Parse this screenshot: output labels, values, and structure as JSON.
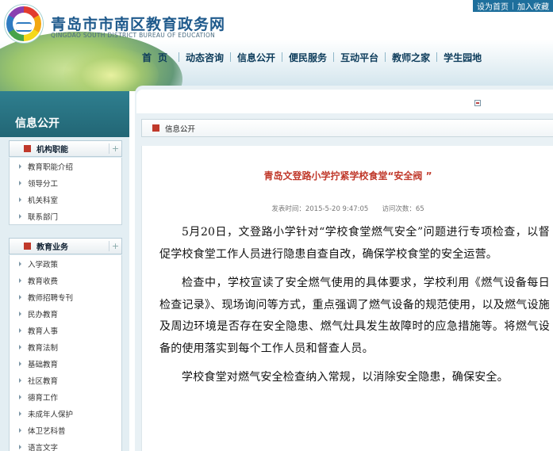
{
  "site": {
    "title": "青岛市市南区教育政务网",
    "subtitle": "QINGDAO SOUTH DISTRICT BUREAU OF EDUCATION",
    "top_links": [
      "设为首页",
      "加入收藏"
    ]
  },
  "nav": [
    "首页",
    "动态咨询",
    "信息公开",
    "便民服务",
    "互动平台",
    "教师之家",
    "学生园地"
  ],
  "sidebar": {
    "title": "信息公开",
    "sections": [
      {
        "label": "机构职能",
        "items": [
          "教育职能介绍",
          "领导分工",
          "机关科室",
          "联系部门"
        ]
      },
      {
        "label": "教育业务",
        "items": [
          "入学政策",
          "教育收费",
          "教师招聘专刊",
          "民办教育",
          "教育人事",
          "教育法制",
          "基础教育",
          "社区教育",
          "德育工作",
          "未成年人保护",
          "体卫艺科普",
          "语言文字"
        ]
      }
    ]
  },
  "breadcrumb": "信息公开",
  "article": {
    "title": "青岛文登路小学拧紧学校食堂“安全阀 ”",
    "meta": "发表时间：2015-5-20 9:47:05　　访问次数：65",
    "paragraphs": [
      "5月20日，文登路小学针对“学校食堂燃气安全”问题进行专项检查，以督促学校食堂工作人员进行隐患自查自改，确保学校食堂的安全运营。",
      "检查中，学校宣读了安全燃气使用的具体要求，学校利用《燃气设备每日检查记录》、现场询问等方式，重点强调了燃气设备的规范使用，以及燃气设施及周边环境是否存在安全隐患、燃气灶具发生故障时的应急措施等。将燃气设备的使用落实到每个工作人员和督查人员。",
      "学校食堂对燃气安全检查纳入常规，以消除安全隐患，确保安全。"
    ]
  },
  "colors": {
    "accent": "#c0392b",
    "nav_text": "#0d3c5b",
    "sidebar_title_bg": "#2f7f8f",
    "toplink_bg": "#1e6f9c"
  }
}
